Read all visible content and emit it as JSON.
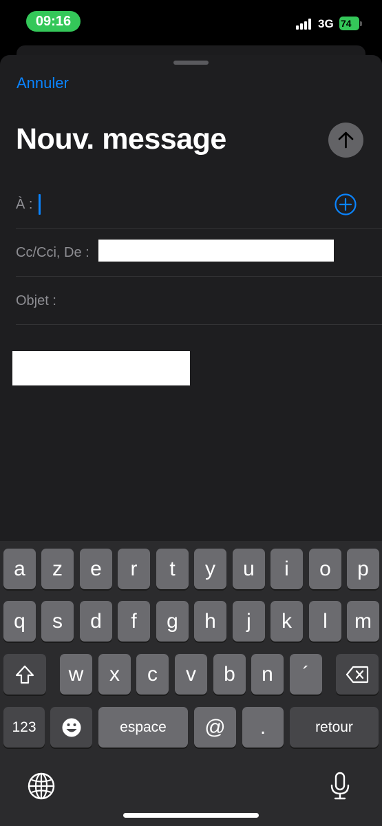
{
  "status_bar": {
    "time": "09:16",
    "network": "3G",
    "battery": "74"
  },
  "compose": {
    "cancel_label": "Annuler",
    "title": "Nouv. message",
    "to_label": "À :",
    "cc_label": "Cc/Cci, De :",
    "subject_label": "Objet :"
  },
  "keyboard": {
    "row1": [
      "a",
      "z",
      "e",
      "r",
      "t",
      "y",
      "u",
      "i",
      "o",
      "p"
    ],
    "row2": [
      "q",
      "s",
      "d",
      "f",
      "g",
      "h",
      "j",
      "k",
      "l",
      "m"
    ],
    "row3": [
      "w",
      "x",
      "c",
      "v",
      "b",
      "n",
      "´"
    ],
    "numbers_label": "123",
    "space_label": "espace",
    "at_label": "@",
    "dot_label": ".",
    "return_label": "retour"
  },
  "colors": {
    "accent": "#0a84ff",
    "time_pill": "#34c759",
    "sheet_background": "#1e1e20",
    "key": "#6b6b6f",
    "function_key": "#464649"
  },
  "icons": {
    "send": "arrow-up-icon",
    "add_recipient": "plus-circle-icon",
    "shift": "shift-arrow-icon",
    "delete": "backspace-icon",
    "emoji": "smiley-icon",
    "language": "globe-icon",
    "dictation": "microphone-icon"
  }
}
